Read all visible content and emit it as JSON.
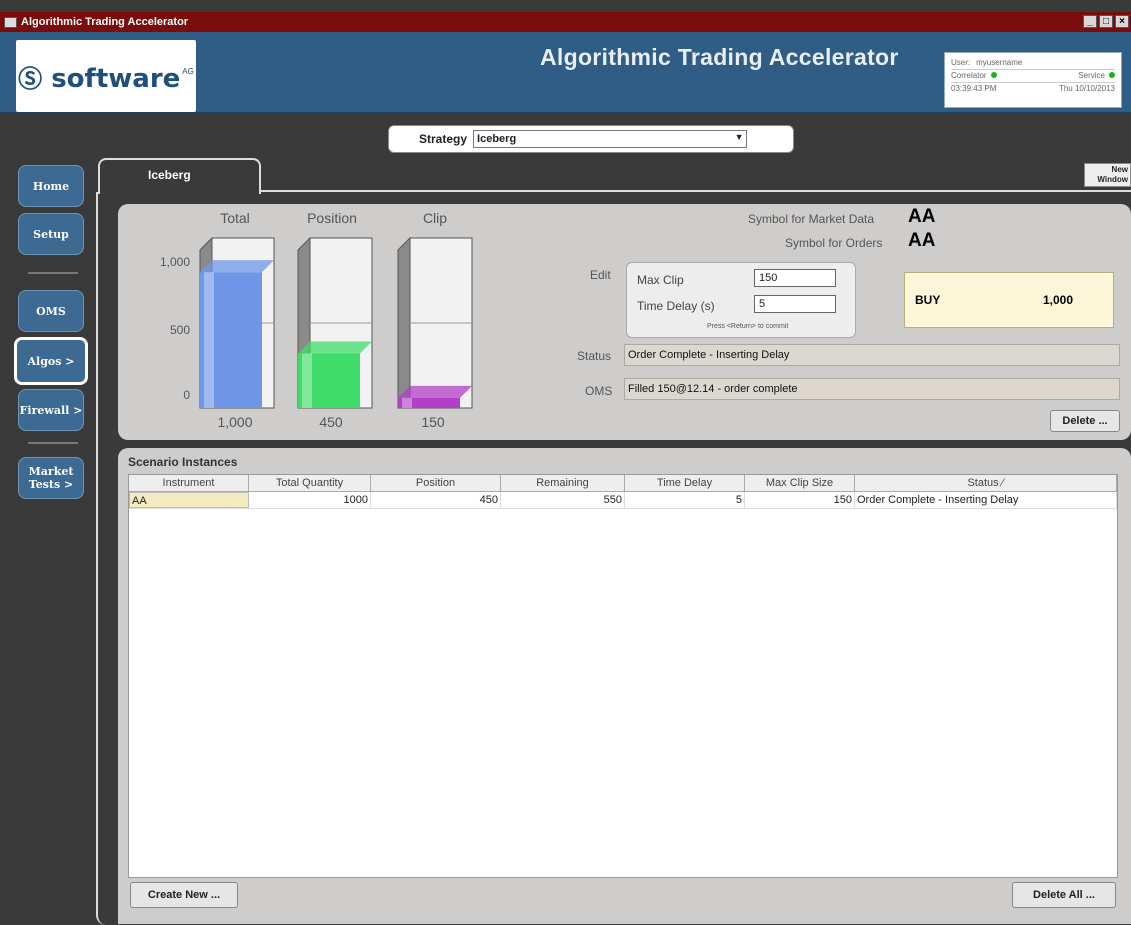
{
  "window": {
    "title": "Algorithmic Trading Accelerator",
    "controls": [
      "_",
      "□",
      "×"
    ]
  },
  "header": {
    "logo_text": "software",
    "logo_sup": "AG",
    "app_title": "Algorithmic Trading Accelerator",
    "user_label": "User:",
    "user_name": "myusername",
    "correlator_label": "Correlator",
    "service_label": "Service",
    "time": "03:39:43 PM",
    "date": "Thu 10/10/2013",
    "status_color": "#12b81a"
  },
  "strategy": {
    "label": "Strategy",
    "selected": "Iceberg"
  },
  "nav": {
    "items": [
      {
        "label": "Home"
      },
      {
        "label": "Setup"
      },
      {
        "label": "OMS"
      },
      {
        "label": "Algos >"
      },
      {
        "label": "Firewall >"
      },
      {
        "label": "Market Tests >"
      }
    ],
    "active_index": 3
  },
  "tab": {
    "label": "Iceberg",
    "new_window": "New Window"
  },
  "chart_data": {
    "type": "bar",
    "categories": [
      "Total",
      "Position",
      "Clip"
    ],
    "values": [
      1000,
      450,
      150
    ],
    "value_labels": [
      "1,000",
      "450",
      "150"
    ],
    "y_ticks": [
      "1,000",
      "500",
      "0"
    ],
    "ylim": [
      0,
      1150
    ],
    "colors": [
      "#6f97e8",
      "#3fdc6a",
      "#b23fc8"
    ]
  },
  "details": {
    "symbol_market_label": "Symbol for Market Data",
    "symbol_market_value": "AA",
    "symbol_orders_label": "Symbol for Orders",
    "symbol_orders_value": "AA",
    "edit_label": "Edit",
    "max_clip_label": "Max Clip",
    "max_clip_value": "150",
    "time_delay_label": "Time Delay (s)",
    "time_delay_value": "5",
    "commit_hint": "Press <Return> to commit",
    "side": "BUY",
    "side_qty": "1,000",
    "status_label": "Status",
    "status_value": "Order Complete - Inserting Delay",
    "oms_label": "OMS",
    "oms_value": "Filled 150@12.14 - order complete",
    "delete_button": "Delete ..."
  },
  "scenarios": {
    "title": "Scenario Instances",
    "columns": [
      "Instrument",
      "Total Quantity",
      "Position",
      "Remaining",
      "Time Delay",
      "Max Clip Size",
      "Status ⁄"
    ],
    "rows": [
      [
        "AA",
        "1000",
        "450",
        "550",
        "5",
        "150",
        "Order Complete - Inserting Delay"
      ]
    ],
    "create_button": "Create New ...",
    "delete_all_button": "Delete All ..."
  }
}
